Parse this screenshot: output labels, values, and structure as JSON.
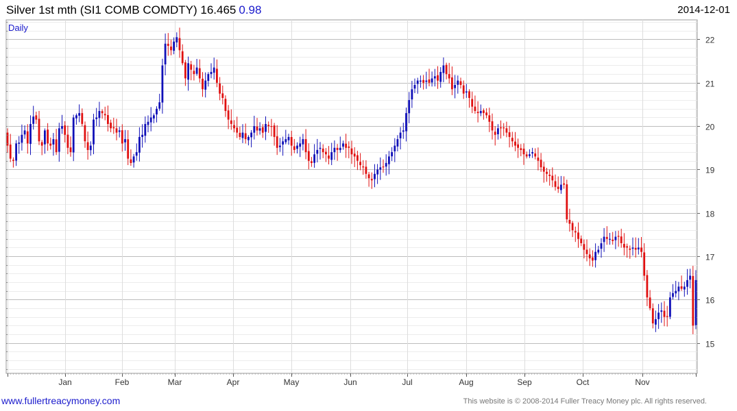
{
  "header": {
    "title": "Silver 1st mth (SI1 COMB COMDTY) 16.465",
    "change": "0.98",
    "date": "2014-12-01"
  },
  "footer": {
    "link_text": "www.fullertreacymoney.com",
    "copyright": "This website is © 2008-2014 Fuller Treacy Money plc. All rights reserved."
  },
  "colors": {
    "up": "#1010b8",
    "down": "#e01010",
    "grid": "#cccccc",
    "frame": "#999999",
    "text": "#333333",
    "change": "#1a1acc"
  },
  "chart_data": {
    "type": "bar",
    "style": "ohlc-candles",
    "frequency_label": "Daily",
    "x_labels": [
      "Jan",
      "Feb",
      "Mar",
      "Apr",
      "May",
      "Jun",
      "Jul",
      "Aug",
      "Sep",
      "Oct",
      "Nov"
    ],
    "y_ticks": [
      15,
      16,
      17,
      18,
      19,
      20,
      21,
      22
    ],
    "y_range": [
      14.3,
      22.45
    ],
    "grid": true,
    "closes": [
      19.55,
      19.25,
      19.2,
      19.6,
      19.62,
      19.8,
      19.9,
      19.6,
      20.05,
      20.22,
      20.15,
      19.65,
      19.55,
      19.9,
      19.6,
      19.55,
      19.7,
      19.4,
      19.95,
      20,
      19.8,
      19.5,
      19.4,
      20.2,
      20.25,
      20.3,
      20.05,
      19.65,
      19.45,
      19.55,
      20.15,
      20.2,
      20.35,
      20.3,
      20.25,
      20.05,
      19.95,
      19.95,
      19.85,
      19.9,
      19.6,
      19.7,
      19.25,
      19.15,
      19.3,
      19.4,
      19.75,
      19.8,
      20.05,
      20.1,
      20.2,
      20.25,
      20.4,
      20.55,
      21.4,
      21.9,
      21.85,
      21.75,
      21.95,
      22.05,
      21.75,
      21.45,
      21.1,
      21.45,
      21.3,
      21.2,
      21.35,
      21.1,
      20.85,
      21.05,
      21.2,
      21.25,
      21.35,
      21,
      20.75,
      20.65,
      20.35,
      20.15,
      20.05,
      19.95,
      19.85,
      19.75,
      19.85,
      19.7,
      19.75,
      19.85,
      20,
      19.9,
      19.95,
      19.85,
      20.05,
      20,
      20,
      19.75,
      19.5,
      19.55,
      19.65,
      19.7,
      19.75,
      19.55,
      19.45,
      19.55,
      19.6,
      19.7,
      19.4,
      19.2,
      19.15,
      19.35,
      19.45,
      19.5,
      19.4,
      19.35,
      19.25,
      19.4,
      19.5,
      19.45,
      19.5,
      19.6,
      19.5,
      19.5,
      19.35,
      19.3,
      19.2,
      19.1,
      19.05,
      18.9,
      18.8,
      18.75,
      18.9,
      19,
      19.05,
      19.05,
      19.15,
      19.3,
      19.4,
      19.55,
      19.7,
      19.85,
      19.9,
      20.3,
      20.6,
      20.85,
      20.95,
      21.05,
      21.05,
      21,
      21.05,
      21,
      21.1,
      21.15,
      21.05,
      21.25,
      21.4,
      21.2,
      21.1,
      20.85,
      20.95,
      21.05,
      20.95,
      20.75,
      20.8,
      20.65,
      20.45,
      20.35,
      20.3,
      20.35,
      20.3,
      20.25,
      20.1,
      19.9,
      19.8,
      19.95,
      19.95,
      19.95,
      19.85,
      19.75,
      19.65,
      19.55,
      19.5,
      19.45,
      19.35,
      19.3,
      19.35,
      19.4,
      19.3,
      19.2,
      19.05,
      18.95,
      18.9,
      18.85,
      18.75,
      18.6,
      18.55,
      18.65,
      18.65,
      17.85,
      17.75,
      17.6,
      17.55,
      17.4,
      17.3,
      17.15,
      17.05,
      16.95,
      16.9,
      17.1,
      17.15,
      17.3,
      17.45,
      17.4,
      17.4,
      17.35,
      17.45,
      17.45,
      17.3,
      17.2,
      17.2,
      17.15,
      17.2,
      17.15,
      17.2,
      17.1,
      16.55,
      16.05,
      15.8,
      15.45,
      15.55,
      15.7,
      15.75,
      15.6,
      15.6,
      16.05,
      16.15,
      16.2,
      16.3,
      16.25,
      16.3,
      16.45,
      16.55,
      15.4,
      16.45
    ]
  }
}
